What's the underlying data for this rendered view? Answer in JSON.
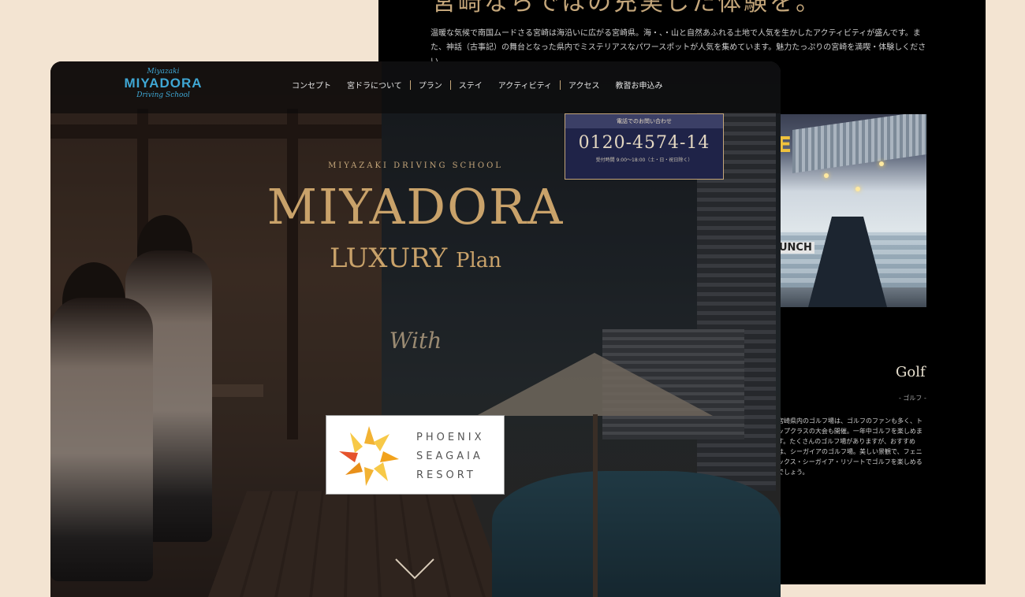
{
  "back_page": {
    "heading": "宮崎ならではの充実した体験を。",
    "paragraph": "温暖な気候で南国ムードさる宮崎は海沿いに広がる宮崎県。海・、・山と自然あふれる土地で人気を生かしたアクティビティが盛んです。また、神話（古事記）の舞台となった県内でミステリアスなパワースポットが人気を集めています。魅力たっぷりの宮崎を満喫・体験しください。",
    "photo_sign_text": "E",
    "photo_board_text": "UNCH",
    "golf_title": "Golf",
    "golf_subtitle": "- ゴルフ -",
    "golf_text": "宮崎県内のゴルフ場は、ゴルフのファンも多く、トップクラスの大会も開催。一年中ゴルフを楽しめます。たくさんのゴルフ場がありますが、おすすめは、シーガイアのゴルフ場。美しい景観で、フェニックス・シーガイア・リゾートでゴルフを楽しめるでしょう。"
  },
  "nav": {
    "logo_script_top": "Miyazaki",
    "logo_main": "MIYADORA",
    "logo_script_bottom": "Driving School",
    "items": [
      {
        "label": "コンセプト"
      },
      {
        "label": "宮ドラについて"
      },
      {
        "label": "プラン"
      },
      {
        "label": "ステイ"
      },
      {
        "label": "アクティビティ"
      },
      {
        "label": "アクセス"
      },
      {
        "label": "教習お申込み"
      }
    ]
  },
  "contact": {
    "header": "電話でのお問い合わせ",
    "phone": "0120-4574-14",
    "hours": "受付時間 9:00～18:00（土・日・祝日除く）"
  },
  "hero": {
    "kicker": "MIYAZAKI DRIVING SCHOOL",
    "title": "MIYADORA",
    "subtitle_main": "LUXURY",
    "subtitle_small": "Plan",
    "with": "With"
  },
  "partner": {
    "line1": "PHOENIX",
    "line2": "SEAGAIA",
    "line3": "RESORT"
  },
  "colors": {
    "background": "#f3e4d2",
    "gold": "#c9a26a",
    "navy": "#1f2348",
    "logo_blue": "#3fa7d4"
  },
  "icons": {
    "scroll": "chevron-down-icon",
    "partner_logo": "phoenix-seagaia-logo-icon"
  }
}
